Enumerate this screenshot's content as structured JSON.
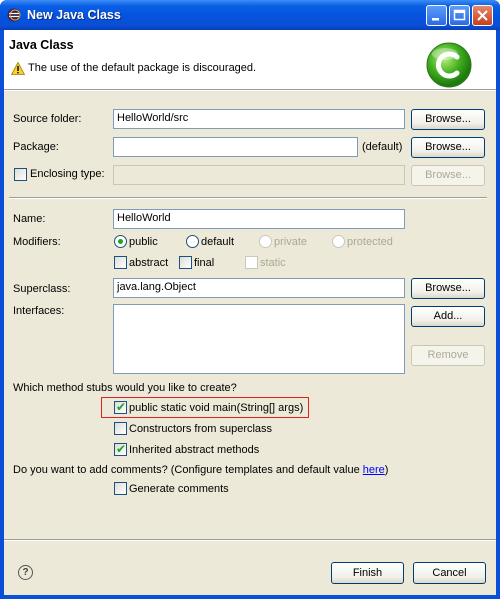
{
  "window": {
    "title": "New Java Class"
  },
  "header": {
    "title": "Java Class",
    "message": "The use of the default package is discouraged."
  },
  "form": {
    "source_folder": {
      "label": "Source folder:",
      "value": "HelloWorld/src",
      "button": "Browse..."
    },
    "package": {
      "label": "Package:",
      "value": "",
      "hint": "(default)",
      "button": "Browse..."
    },
    "enclosing_type": {
      "label": "Enclosing type:",
      "checked": false,
      "value": "",
      "button": "Browse..."
    },
    "name": {
      "label": "Name:",
      "value": "HelloWorld"
    },
    "modifiers": {
      "label": "Modifiers:",
      "options": [
        "public",
        "default",
        "private",
        "protected"
      ],
      "selected": "public",
      "abstract": "abstract",
      "final": "final",
      "static": "static"
    },
    "superclass": {
      "label": "Superclass:",
      "value": "java.lang.Object",
      "button": "Browse..."
    },
    "interfaces": {
      "label": "Interfaces:",
      "add_button": "Add...",
      "remove_button": "Remove"
    },
    "stubs": {
      "question": "Which method stubs would you like to create?",
      "main": {
        "label": "public static void main(String[] args)",
        "checked": true
      },
      "constructors": {
        "label": "Constructors from superclass",
        "checked": false
      },
      "inherited": {
        "label": "Inherited abstract methods",
        "checked": true
      }
    },
    "comments": {
      "question": "Do you want to add comments? (Configure templates and default value ",
      "link": "here",
      "question_end": ")",
      "generate": {
        "label": "Generate comments",
        "checked": false
      }
    }
  },
  "footer": {
    "finish": "Finish",
    "cancel": "Cancel"
  },
  "colors": {
    "titlebar": "#0553df",
    "dialog_bg": "#ece9d8",
    "check": "#21a121",
    "highlight_border": "#dd2222"
  }
}
